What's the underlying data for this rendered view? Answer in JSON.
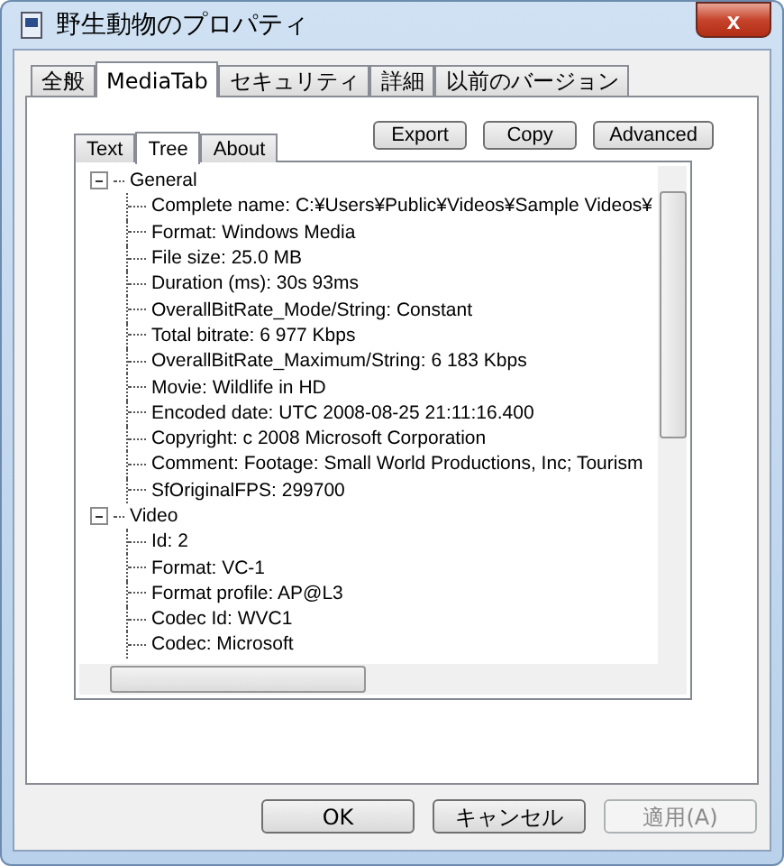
{
  "window": {
    "title": "野生動物のプロパティ",
    "close": "x"
  },
  "tabs": [
    {
      "label": "全般",
      "selected": false
    },
    {
      "label": "MediaTab",
      "selected": true
    },
    {
      "label": "セキュリティ",
      "selected": false
    },
    {
      "label": "詳細",
      "selected": false
    },
    {
      "label": "以前のバージョン",
      "selected": false
    }
  ],
  "subtabs": [
    {
      "label": "Text",
      "selected": false
    },
    {
      "label": "Tree",
      "selected": true
    },
    {
      "label": "About",
      "selected": false
    }
  ],
  "toolbar": [
    "Export",
    "Copy",
    "Advanced"
  ],
  "tree": [
    {
      "label": "General",
      "expanded": true,
      "children": [
        "Complete name: C:¥Users¥Public¥Videos¥Sample Videos¥",
        "Format: Windows Media",
        "File size: 25.0 MB",
        "Duration (ms): 30s 93ms",
        "OverallBitRate_Mode/String: Constant",
        "Total bitrate: 6 977 Kbps",
        "OverallBitRate_Maximum/String: 6 183 Kbps",
        "Movie: Wildlife in HD",
        "Encoded date: UTC 2008-08-25 21:11:16.400",
        "Copyright: c 2008 Microsoft Corporation",
        "Comment: Footage: Small World Productions, Inc; Tourism",
        "SfOriginalFPS: 299700"
      ]
    },
    {
      "label": "Video",
      "expanded": true,
      "children": [
        "Id: 2",
        "Format: VC-1",
        "Format profile: AP@L3",
        "Codec Id: WVC1",
        "Codec: Microsoft"
      ]
    }
  ],
  "buttons": [
    {
      "label": "OK",
      "disabled": false
    },
    {
      "label": "キャンセル",
      "disabled": false
    },
    {
      "label": "適用(A)",
      "disabled": true
    }
  ]
}
